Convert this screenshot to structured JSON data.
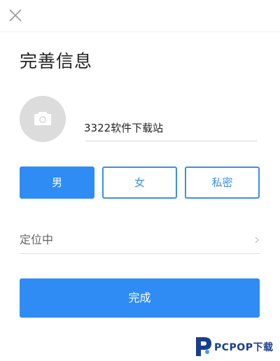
{
  "header": {
    "close_icon": "close-icon"
  },
  "title": "完善信息",
  "profile": {
    "avatar_icon": "camera-icon",
    "nickname": "3322软件下载站"
  },
  "gender": {
    "options": [
      "男",
      "女",
      "私密"
    ],
    "selected": "男"
  },
  "location": {
    "text": "定位中",
    "chevron_icon": "chevron-right-icon"
  },
  "actions": {
    "done_label": "完成"
  },
  "watermark": {
    "text": "PCPOP下载"
  },
  "colors": {
    "accent": "#2f8cf5",
    "outline": "#3a8fe8",
    "avatar_bg": "#dcdcdc",
    "watermark": "#1a3e8c"
  }
}
